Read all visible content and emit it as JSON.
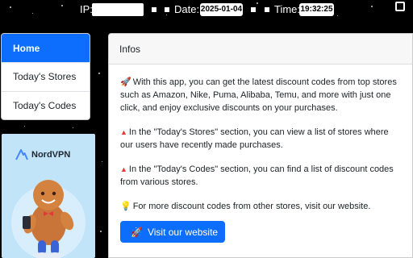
{
  "status_bar": {
    "ip_label": "IP:",
    "date_label": "Date:",
    "date_value": "2025-01-04",
    "time_label": "Time:",
    "time_value": "19:32:25"
  },
  "menu": {
    "items": [
      {
        "label": "Home",
        "active": true
      },
      {
        "label": "Today's Stores",
        "active": false
      },
      {
        "label": "Today's Codes",
        "active": false
      }
    ]
  },
  "ad": {
    "brand": "NordVPN",
    "background": "#c2e4f9"
  },
  "card": {
    "title": "Infos",
    "paragraphs": [
      {
        "icon": "rocket-icon",
        "text": "With this app, you can get the latest discount codes from top stores such as Amazon, Nike, Puma, Alibaba, Temu, and more with just one click, and enjoy exclusive discounts on your purchases."
      },
      {
        "icon": "red-triangle-icon",
        "text": "In the \"Today's Stores\" section, you can view a list of stores where our users have recently made purchases."
      },
      {
        "icon": "red-triangle-icon",
        "text": "In the \"Today's Codes\" section, you can find a list of discount codes from various stores."
      },
      {
        "icon": "lightbulb-icon",
        "text": "For more discount codes from other stores, visit our website."
      }
    ],
    "button_label": "Visit our website",
    "button_icon": "rocket-icon"
  },
  "colors": {
    "primary": "#0d6efd",
    "page_bg": "#000000"
  }
}
